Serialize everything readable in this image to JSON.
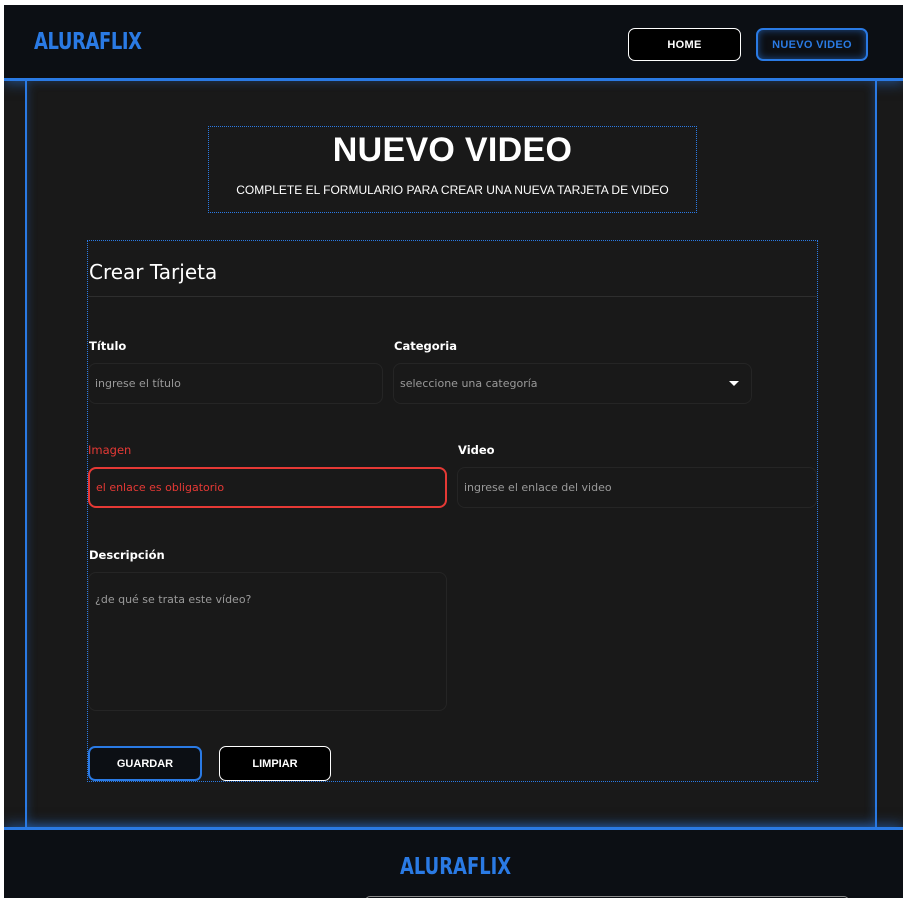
{
  "header": {
    "logo": "ALURAFLIX",
    "nav": {
      "home_label": "HOME",
      "new_video_label": "NUEVO VIDEO"
    }
  },
  "page": {
    "title": "NUEVO VIDEO",
    "subtitle": "COMPLETE EL FORMULARIO PARA CREAR UNA NUEVA TARJETA DE VIDEO"
  },
  "form": {
    "title": "Crear Tarjeta",
    "fields": {
      "titulo": {
        "label": "Título",
        "placeholder": "ingrese el título"
      },
      "categoria": {
        "label": "Categoria",
        "placeholder": "seleccione una categoría"
      },
      "imagen": {
        "label": "Imagen",
        "error": "el enlace es obligatorio"
      },
      "video": {
        "label": "Video",
        "placeholder": "ingrese el enlace del video"
      },
      "descripcion": {
        "label": "Descripción",
        "placeholder": "¿de qué se trata este vídeo?"
      }
    },
    "buttons": {
      "save_label": "GUARDAR",
      "clear_label": "LIMPIAR"
    }
  },
  "footer": {
    "logo": "ALURAFLIX"
  },
  "colors": {
    "accent": "#2a7ae4",
    "error": "#e53935",
    "background": "#191919",
    "bar": "#0c0f14"
  },
  "icons": {
    "select_arrow": "caret-down-icon"
  }
}
